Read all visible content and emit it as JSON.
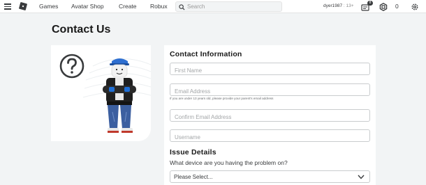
{
  "nav": {
    "links": [
      "Games",
      "Avatar Shop",
      "Create",
      "Robux"
    ],
    "search_placeholder": "Search",
    "username": "dyer1987",
    "user_age": ": 13+",
    "notifications_count": "8",
    "robux_count": "0"
  },
  "page": {
    "title": "Contact Us"
  },
  "form": {
    "contact_title": "Contact Information",
    "first_name_placeholder": "First Name",
    "email_placeholder": "Email Address",
    "email_hint": "If you are under 13 years old, please provide your parent's email address",
    "confirm_email_placeholder": "Confirm Email Address",
    "username_placeholder": "Username",
    "issue_title": "Issue Details",
    "device_question": "What device are you having the problem on?",
    "device_select_value": "Please Select..."
  },
  "icons": {
    "menu": "hamburger-menu-icon",
    "logo": "roblox-logo",
    "search": "search-icon",
    "notifications": "notifications-icon",
    "robux": "robux-icon",
    "settings": "gear-icon",
    "help": "question-mark-icon",
    "dropdown": "chevron-down-icon"
  },
  "colors": {
    "background": "#f2f4f5",
    "card": "#ffffff",
    "text": "#191919",
    "border": "#c9ccce"
  }
}
